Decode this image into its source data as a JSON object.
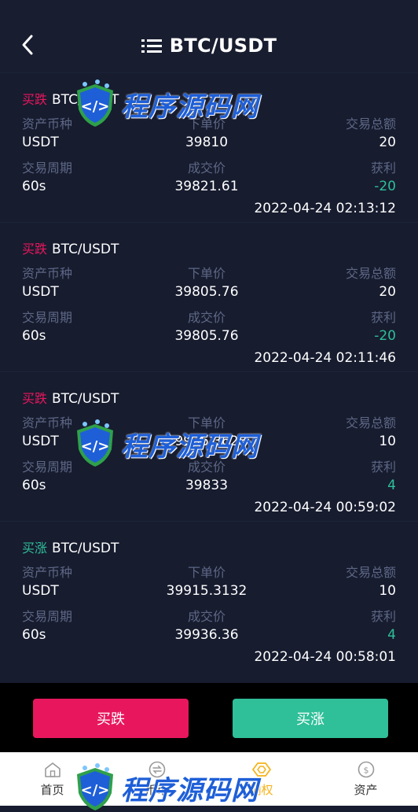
{
  "header": {
    "title": "BTC/USDT"
  },
  "labels": {
    "asset": "资产币种",
    "order_price": "下单价",
    "total": "交易总额",
    "period": "交易周期",
    "deal_price": "成交价",
    "profit": "获利"
  },
  "orders": [
    {
      "direction": "买跌",
      "pair": "BTC/USDT",
      "asset": "USDT",
      "order_price": "39810",
      "total": "20",
      "period": "60s",
      "deal_price": "39821.61",
      "profit": "-20",
      "time": "2022-04-24 02:13:12"
    },
    {
      "direction": "买跌",
      "pair": "BTC/USDT",
      "asset": "USDT",
      "order_price": "39805.76",
      "total": "20",
      "period": "60s",
      "deal_price": "39805.76",
      "profit": "-20",
      "time": "2022-04-24 02:11:46"
    },
    {
      "direction": "买跌",
      "pair": "BTC/USDT",
      "asset": "USDT",
      "order_price": "39936.3628",
      "total": "10",
      "period": "60s",
      "deal_price": "39833",
      "profit": "4",
      "time": "2022-04-24 00:59:02"
    },
    {
      "direction": "买涨",
      "pair": "BTC/USDT",
      "asset": "USDT",
      "order_price": "39915.3132",
      "total": "10",
      "period": "60s",
      "deal_price": "39936.36",
      "profit": "4",
      "time": "2022-04-24 00:58:01"
    }
  ],
  "actions": {
    "buy_down": "买跌",
    "buy_up": "买涨"
  },
  "tabs": [
    {
      "label": "首页",
      "icon": "home-icon"
    },
    {
      "label": "币币",
      "icon": "exchange-icon"
    },
    {
      "label": "期权",
      "icon": "options-icon"
    },
    {
      "label": "资产",
      "icon": "assets-icon"
    }
  ],
  "watermark": {
    "text": "程序源码网"
  },
  "colors": {
    "background": "#171c2f",
    "down": "#e8175d",
    "up": "#2fbf99",
    "active_tab": "#f5b31a"
  }
}
